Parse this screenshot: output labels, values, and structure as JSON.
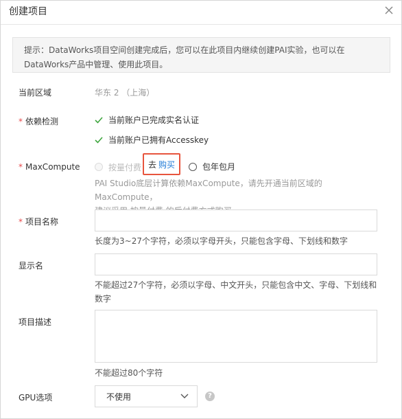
{
  "dialog": {
    "title": "创建项目"
  },
  "notice": {
    "line1": "提示：DataWorks项目空间创建完成后，您可以在此项目内继续创建PAI实验，也可以在",
    "line2": "DataWorks产品中管理、使用此项目。"
  },
  "region": {
    "label": "当前区域",
    "value": "华东 2 （上海）"
  },
  "dependency": {
    "label": "依赖检测",
    "checks": [
      "当前账户已完成实名认证",
      "当前账户已拥有Accesskey"
    ]
  },
  "maxcompute": {
    "label": "MaxCompute",
    "option_payg": "按量付费",
    "buy_prefix": "去",
    "buy_link": "购买",
    "option_yearly": "包年包月",
    "desc_line1": "PAI Studio底层计算依赖MaxCompute，请先开通当前区域的MaxCompute，",
    "desc_line2": "建议采用 按量付费 的后付费方式购买。"
  },
  "project_name": {
    "label": "项目名称",
    "value": "",
    "hint": "长度为3~27个字符，必须以字母开头，只能包含字母、下划线和数字"
  },
  "display_name": {
    "label": "显示名",
    "value": "",
    "hint_line1": "不能超过27个字符，必须以字母、中文开头，只能包含中文、字母、下划线和",
    "hint_line2": "数字"
  },
  "description": {
    "label": "项目描述",
    "value": "",
    "hint": "不能超过80个字符"
  },
  "gpu": {
    "label": "GPU选项",
    "selected": "不使用",
    "help": "?"
  },
  "icons": {
    "close": "close-icon",
    "check": "check-icon",
    "chevron": "chevron-down-icon",
    "help": "help-icon"
  },
  "colors": {
    "required": "#e8494b",
    "check": "#3fa63f",
    "link": "#1f7ad6",
    "highlight": "#e7543d"
  }
}
